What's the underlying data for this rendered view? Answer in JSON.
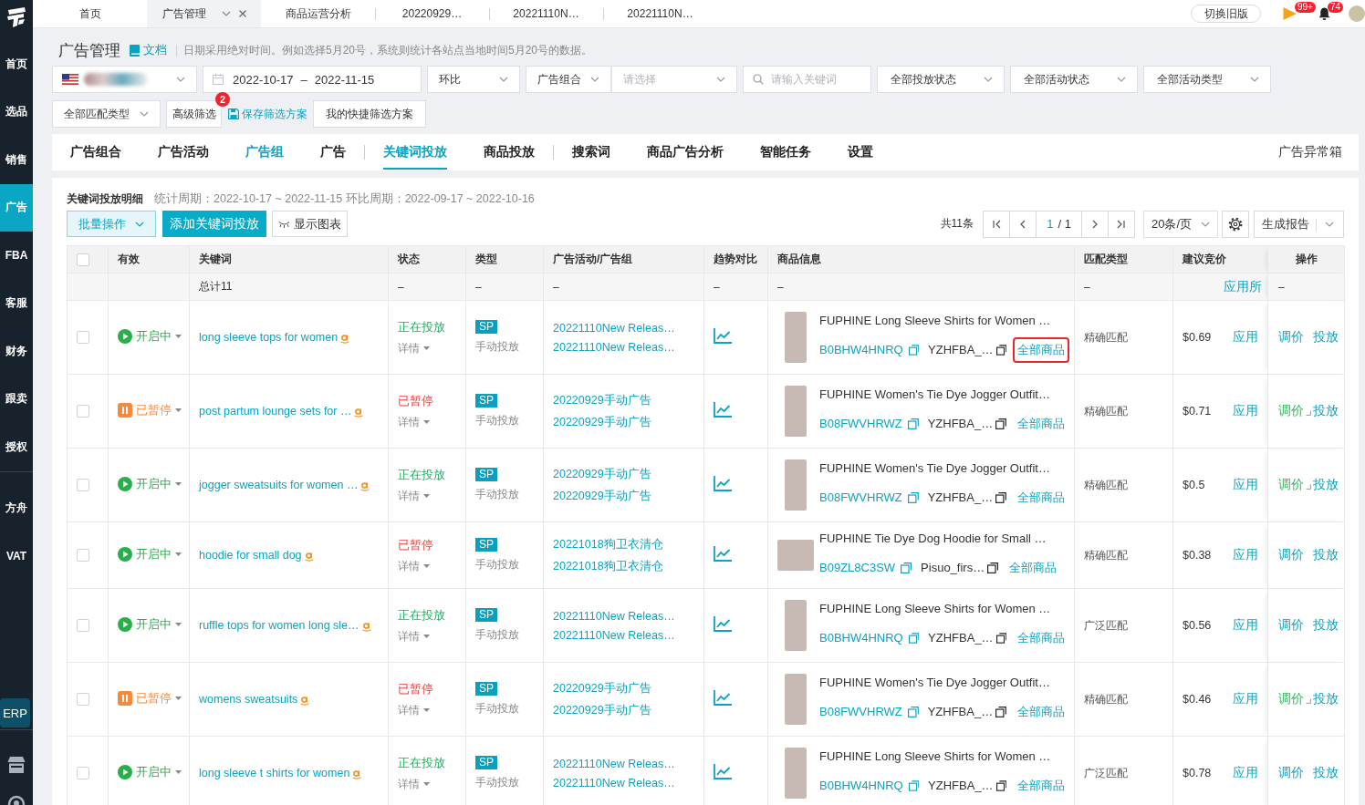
{
  "sidebar": {
    "sections": [
      [
        {
          "label": "首页",
          "selected": false
        },
        {
          "label": "选品",
          "selected": false
        },
        {
          "label": "销售",
          "selected": false
        },
        {
          "label": "广告",
          "selected": true
        },
        {
          "label": "FBA",
          "selected": false
        },
        {
          "label": "客服",
          "selected": false
        },
        {
          "label": "财务",
          "selected": false
        },
        {
          "label": "跟卖",
          "selected": false
        },
        {
          "label": "授权",
          "selected": false
        }
      ],
      [
        {
          "label": "方舟",
          "selected": false
        },
        {
          "label": "VAT",
          "selected": false
        }
      ]
    ],
    "erp": {
      "label": "ERP"
    }
  },
  "top_tabs": [
    {
      "label": "首页",
      "selected": false
    },
    {
      "label": "广告管理",
      "selected": true
    },
    {
      "label": "商品运营分析",
      "selected": false
    },
    {
      "label": "20220929…",
      "selected": false
    },
    {
      "label": "20221110N…",
      "selected": false
    },
    {
      "label": "20221110N…",
      "selected": false
    }
  ],
  "top_actions": {
    "switch_button": "切换旧版",
    "flag_badge": "99+",
    "bell_badge": "74"
  },
  "header": {
    "title": "广告管理",
    "doc_link": "文档",
    "note": "日期采用绝对时间。例如选择5月20号，系统则统计各站点当地时间5月20号的数据。"
  },
  "filters": {
    "date_range": {
      "start": "2022-10-17",
      "separator": "–",
      "end": "2022-11-15"
    },
    "compare": "环比",
    "portfolio": {
      "label": "广告组合",
      "placeholder": "请选择"
    },
    "search": {
      "placeholder": "请输入关键词"
    },
    "selects": [
      "全部投放状态",
      "全部活动状态",
      "全部活动类型"
    ],
    "match_select": "全部匹配类型",
    "advanced": {
      "label": "高级筛选",
      "badge": "2"
    },
    "save_link": "保存筛选方案",
    "quick_button": "我的快捷筛选方案"
  },
  "section_tabs": {
    "groups": [
      [
        {
          "label": "广告组合",
          "selected": false,
          "highlighted": false
        },
        {
          "label": "广告活动",
          "selected": false,
          "highlighted": false
        },
        {
          "label": "广告组",
          "selected": false,
          "highlighted": true
        },
        {
          "label": "广告",
          "selected": false,
          "highlighted": false
        }
      ],
      [
        {
          "label": "关键词投放",
          "selected": true,
          "highlighted": false
        },
        {
          "label": "商品投放",
          "selected": false,
          "highlighted": false
        }
      ],
      [
        {
          "label": "搜索词",
          "selected": false,
          "highlighted": false
        },
        {
          "label": "商品广告分析",
          "selected": false,
          "highlighted": false
        },
        {
          "label": "智能任务",
          "selected": false,
          "highlighted": false
        },
        {
          "label": "设置",
          "selected": false,
          "highlighted": false
        }
      ]
    ],
    "extra": "广告异常箱"
  },
  "panel": {
    "title": "关键词投放明细",
    "period": "统计周期：2022-10-17 ~ 2022-11-15 环比周期：2022-09-17 ~ 2022-10-16",
    "batch_button": "批量操作",
    "add_button": "添加关键词投放",
    "chart_button": "显示图表",
    "total": "共11条",
    "pagination": {
      "current": "1",
      "separator": "/",
      "pages": "1"
    },
    "page_size": "20条/页",
    "report_button": "生成报告"
  },
  "table": {
    "all_checked": false,
    "columns": [
      "有效",
      "关键词",
      "状态",
      "类型",
      "广告活动/广告组",
      "趋势对比",
      "商品信息",
      "匹配类型",
      "建议竞价",
      "操作"
    ],
    "total_row": {
      "keyword": "总计11",
      "status": "–",
      "type": "–",
      "campaign": "–",
      "trend": "–",
      "product": "–",
      "match": "–",
      "bid_link": "应用所",
      "ops": "–"
    },
    "rows": [
      {
        "checked": false,
        "on": true,
        "enabled_label": "开启中",
        "keyword": "long sleeve tops for women",
        "running": true,
        "status": "正在投放",
        "detail": "详情",
        "ad_type": "SP",
        "targeting": "手动投放",
        "campaign": "20221110New Releas…",
        "ad_group": "20221110New Releas…",
        "wide_photo": false,
        "product_title": "FUPHINE Long Sleeve Shirts for Women …",
        "asin": "B0BHW4HNRQ",
        "sku": "YZHFBA_…",
        "all_products": "全部商品",
        "highlighted": true,
        "match": "精确匹配",
        "bid": "$0.69",
        "apply": "应用",
        "adjust": "调价",
        "rule": false,
        "deploy": "投放"
      },
      {
        "checked": false,
        "on": false,
        "enabled_label": "已暂停",
        "keyword": "post partum lounge sets for …",
        "running": false,
        "status": "已暂停",
        "detail": "详情",
        "ad_type": "SP",
        "targeting": "手动投放",
        "campaign": "20220929手动广告",
        "ad_group": "20220929手动广告",
        "wide_photo": false,
        "product_title": "FUPHINE Women's Tie Dye Jogger Outfit…",
        "asin": "B08FWVHRWZ",
        "sku": "YZHFBA_…",
        "all_products": "全部商品",
        "highlighted": false,
        "match": "精确匹配",
        "bid": "$0.71",
        "apply": "应用",
        "adjust": "调价",
        "rule": true,
        "deploy": "投放"
      },
      {
        "checked": false,
        "on": true,
        "enabled_label": "开启中",
        "keyword": "jogger sweatsuits for women …",
        "running": true,
        "status": "正在投放",
        "detail": "详情",
        "ad_type": "SP",
        "targeting": "手动投放",
        "campaign": "20220929手动广告",
        "ad_group": "20220929手动广告",
        "wide_photo": false,
        "product_title": "FUPHINE Women's Tie Dye Jogger Outfit…",
        "asin": "B08FWVHRWZ",
        "sku": "YZHFBA_…",
        "all_products": "全部商品",
        "highlighted": false,
        "match": "精确匹配",
        "bid": "$0.5",
        "apply": "应用",
        "adjust": "调价",
        "rule": true,
        "deploy": "投放"
      },
      {
        "checked": false,
        "on": true,
        "enabled_label": "开启中",
        "keyword": "hoodie for small dog",
        "running": false,
        "status": "已暂停",
        "detail": "详情",
        "ad_type": "SP",
        "targeting": "手动投放",
        "campaign": "20221018狗卫衣清仓",
        "ad_group": "20221018狗卫衣清仓",
        "wide_photo": true,
        "product_title": "FUPHINE Tie Dye Dog Hoodie for Small …",
        "asin": "B09ZL8C3SW",
        "sku": "Pisuo_firs…",
        "all_products": "全部商品",
        "highlighted": false,
        "match": "精确匹配",
        "bid": "$0.38",
        "apply": "应用",
        "adjust": "调价",
        "rule": false,
        "deploy": "投放"
      },
      {
        "checked": false,
        "on": true,
        "enabled_label": "开启中",
        "keyword": "ruffle tops for women long sle…",
        "running": true,
        "status": "正在投放",
        "detail": "详情",
        "ad_type": "SP",
        "targeting": "手动投放",
        "campaign": "20221110New Releas…",
        "ad_group": "20221110New Releas…",
        "wide_photo": false,
        "product_title": "FUPHINE Long Sleeve Shirts for Women …",
        "asin": "B0BHW4HNRQ",
        "sku": "YZHFBA_…",
        "all_products": "全部商品",
        "highlighted": false,
        "match": "广泛匹配",
        "bid": "$0.56",
        "apply": "应用",
        "adjust": "调价",
        "rule": false,
        "deploy": "投放"
      },
      {
        "checked": false,
        "on": false,
        "enabled_label": "已暂停",
        "keyword": "womens sweatsuits",
        "running": false,
        "status": "已暂停",
        "detail": "详情",
        "ad_type": "SP",
        "targeting": "手动投放",
        "campaign": "20220929手动广告",
        "ad_group": "20220929手动广告",
        "wide_photo": false,
        "product_title": "FUPHINE Women's Tie Dye Jogger Outfit…",
        "asin": "B08FWVHRWZ",
        "sku": "YZHFBA_…",
        "all_products": "全部商品",
        "highlighted": false,
        "match": "精确匹配",
        "bid": "$0.46",
        "apply": "应用",
        "adjust": "调价",
        "rule": true,
        "deploy": "投放"
      },
      {
        "checked": false,
        "on": true,
        "enabled_label": "开启中",
        "keyword": "long sleeve t shirts for women",
        "running": true,
        "status": "正在投放",
        "detail": "详情",
        "ad_type": "SP",
        "targeting": "手动投放",
        "campaign": "20221110New Releas…",
        "ad_group": "20221110New Releas…",
        "wide_photo": false,
        "product_title": "FUPHINE Long Sleeve Shirts for Women …",
        "asin": "B0BHW4HNRQ",
        "sku": "YZHFBA_…",
        "all_products": "全部商品",
        "highlighted": false,
        "match": "广泛匹配",
        "bid": "$0.78",
        "apply": "应用",
        "adjust": "调价",
        "rule": false,
        "deploy": "投放"
      }
    ]
  }
}
